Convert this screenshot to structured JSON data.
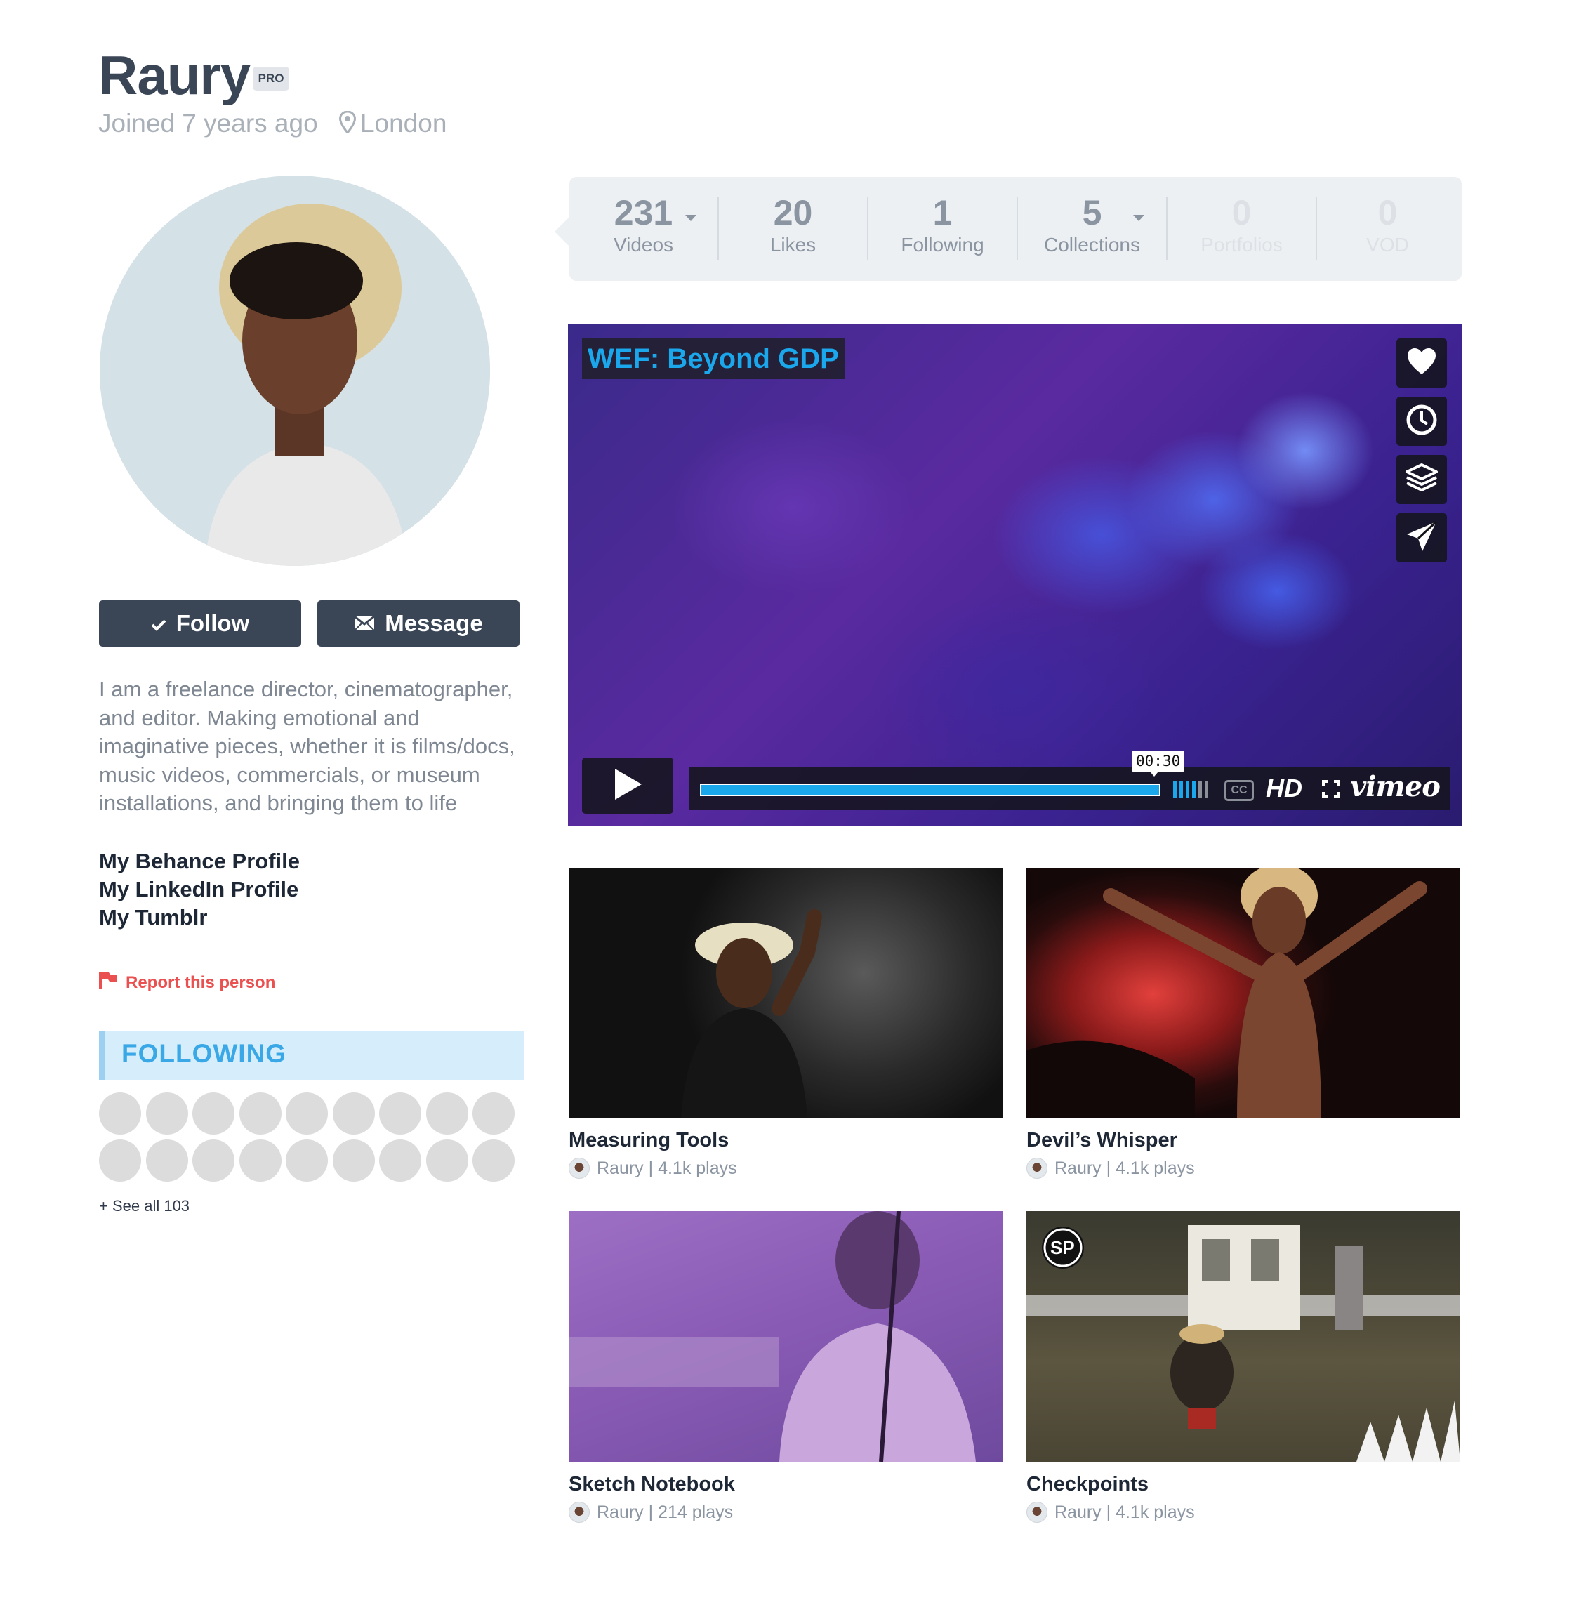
{
  "profile": {
    "name": "Raury",
    "badge": "PRO",
    "joined": "Joined 7 years ago",
    "location": "London",
    "follow_label": "Follow",
    "message_label": "Message",
    "bio": "I am a freelance director, cinematographer, and editor. Making emotional and imaginative pieces, whether it is films/docs, music videos, commercials, or museum installations, and bringing them to life",
    "links": [
      "My Behance Profile",
      "My LinkedIn Profile",
      "My Tumblr"
    ],
    "report_label": "Report this person"
  },
  "following_section": {
    "heading": "FOLLOWING",
    "see_all": "+ See all 103",
    "avatar_rows": 2,
    "avatars_per_row": 9
  },
  "stats": [
    {
      "value": "231",
      "label": "Videos",
      "dropdown": true,
      "muted": false
    },
    {
      "value": "20",
      "label": "Likes",
      "dropdown": false,
      "muted": false
    },
    {
      "value": "1",
      "label": "Following",
      "dropdown": false,
      "muted": false
    },
    {
      "value": "5",
      "label": "Collections",
      "dropdown": true,
      "muted": false
    },
    {
      "value": "0",
      "label": "Portfolios",
      "dropdown": false,
      "muted": true
    },
    {
      "value": "0",
      "label": "VOD",
      "dropdown": false,
      "muted": true
    }
  ],
  "player": {
    "title": "WEF: Beyond GDP",
    "time_tooltip": "00:30",
    "progress_fraction": 1.0,
    "cc_label": "CC",
    "hd_label": "HD",
    "brand": "vimeo",
    "side_actions": [
      "heart-icon",
      "clock-icon",
      "layers-icon",
      "send-icon"
    ]
  },
  "videos": [
    {
      "title": "Measuring Tools",
      "meta": "Raury | 4.1k plays"
    },
    {
      "title": "Devil’s Whisper",
      "meta": "Raury | 4.1k plays"
    },
    {
      "title": "Sketch Notebook",
      "meta": "Raury | 214 plays"
    },
    {
      "title": "Checkpoints",
      "meta": "Raury | 4.1k plays"
    }
  ],
  "colors": {
    "primary": "#3a4656",
    "accent_blue": "#1aa7ec",
    "report_red": "#e9504f",
    "following_bg": "#d6eefb"
  }
}
